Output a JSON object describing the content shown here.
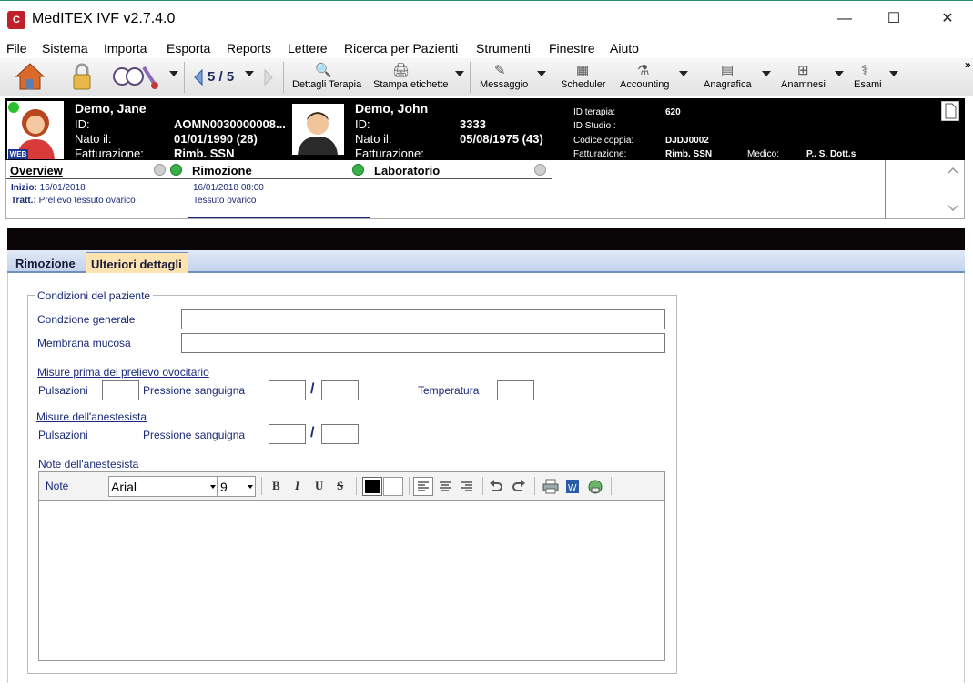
{
  "window": {
    "title": "MedITEX IVF v2.7.4.0",
    "logo": "C",
    "minimize": "—",
    "maximize": "☐",
    "close": "✕"
  },
  "menu": [
    "File",
    "Sistema",
    "Importa",
    "Esporta",
    "Reports",
    "Lettere",
    "Ricerca per Pazienti",
    "Strumenti",
    "Finestre",
    "Aiuto"
  ],
  "toolbar": {
    "page_indicator": "5 / 5",
    "dettagli_terapia": "Dettagli Terapia",
    "stampa_etichette": "Stampa etichette",
    "messaggio": "Messaggio",
    "scheduler": "Scheduler",
    "accounting": "Accounting",
    "anagrafica": "Anagrafica",
    "anamnesi": "Anamnesi",
    "esami": "Esami",
    "more": "»"
  },
  "patient": {
    "female": {
      "name": "Demo, Jane",
      "id_label": "ID:",
      "id_value": "AOMN0030000008...",
      "dob_label": "Nato il:",
      "dob_value": "01/01/1990  (28)",
      "billing_label": "Fatturazione:",
      "billing_value": "Rimb. SSN",
      "web_badge": "WEB"
    },
    "male": {
      "name": "Demo, John",
      "id_label": "ID:",
      "id_value": "3333",
      "dob_label": "Nato il:",
      "dob_value": "05/08/1975  (43)",
      "billing_label": "Fatturazione:"
    },
    "therapy": {
      "id_terapia_label": "ID terapia:",
      "id_terapia_value": "620",
      "id_studio_label": "ID Studio :",
      "codice_coppia_label": "Codice coppia:",
      "codice_coppia_value": "DJDJ0002",
      "fatturazione_label": "Fatturazione:",
      "fatturazione_value": "Rimb. SSN",
      "medico_label": "Medico:",
      "medico_value": "P.. S. Dott.s"
    }
  },
  "overview": {
    "col1": {
      "title": "Overview",
      "inizio_label": "Inizio:",
      "inizio_value": "16/01/2018",
      "tratt_label": "Tratt.:",
      "tratt_value": "Prelievo tessuto ovarico"
    },
    "col2": {
      "title": "Rimozione",
      "line1": "16/01/2018 08:00",
      "line2": "Tessuto ovarico"
    },
    "col3": {
      "title": "Laboratorio"
    }
  },
  "tabs": [
    {
      "label": "Rimozione",
      "active": false
    },
    {
      "label": "Ulteriori dettagli",
      "active": true
    }
  ],
  "form": {
    "group_title": "Condizioni del paziente",
    "condizione_label": "Condzione generale",
    "condizione_value": "",
    "membrana_label": "Membrana mucosa",
    "membrana_value": "",
    "misure_prima_label": "Misure prima del prelievo ovocitario",
    "pulsazioni_label": "Pulsazioni",
    "pressione_label": "Pressione sanguigna",
    "slash": "/",
    "temperatura_label": "Temperatura",
    "misure_anest_label": "Misure dell'anestesista",
    "note_anest_label": "Note dell'anestesista",
    "note_label": "Note",
    "font_value": "Arial",
    "size_value": "9",
    "note_text": ""
  },
  "colors": {
    "accent_blue": "#1a2a7a",
    "header_black": "#000000",
    "active_tab": "#fde3b0",
    "status_green": "#3ab04a"
  }
}
